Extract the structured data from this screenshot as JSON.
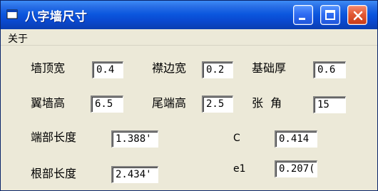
{
  "window": {
    "title": "八字墙尺寸"
  },
  "menu": {
    "items": [
      "关于"
    ]
  },
  "form": {
    "qiang_ding_kuan": {
      "label": "墙顶宽",
      "value": "0.4"
    },
    "qin_bian_kuan": {
      "label": "襟边宽",
      "value": "0.2"
    },
    "ji_chu_hou": {
      "label": "基础厚",
      "value": "0.6"
    },
    "yi_qiang_gao": {
      "label": "翼墙高",
      "value": "6.5"
    },
    "wei_duan_gao": {
      "label": "尾端高",
      "value": "2.5"
    },
    "zhang_jiao": {
      "label": "张  角",
      "value": "15"
    },
    "duan_bu_chang_du": {
      "label": "端部长度",
      "value": "1.388'"
    },
    "c": {
      "label": "C",
      "value": "0.414"
    },
    "gen_bu_chang_du": {
      "label": "根部长度",
      "value": "2.434'"
    },
    "e1": {
      "label": "e1",
      "value": "0.207("
    }
  },
  "colors": {
    "titlebar_start": "#3d8cf6",
    "titlebar_end": "#0a3fb3",
    "window_bg": "#ece9d8",
    "close_button": "#e25a35"
  }
}
